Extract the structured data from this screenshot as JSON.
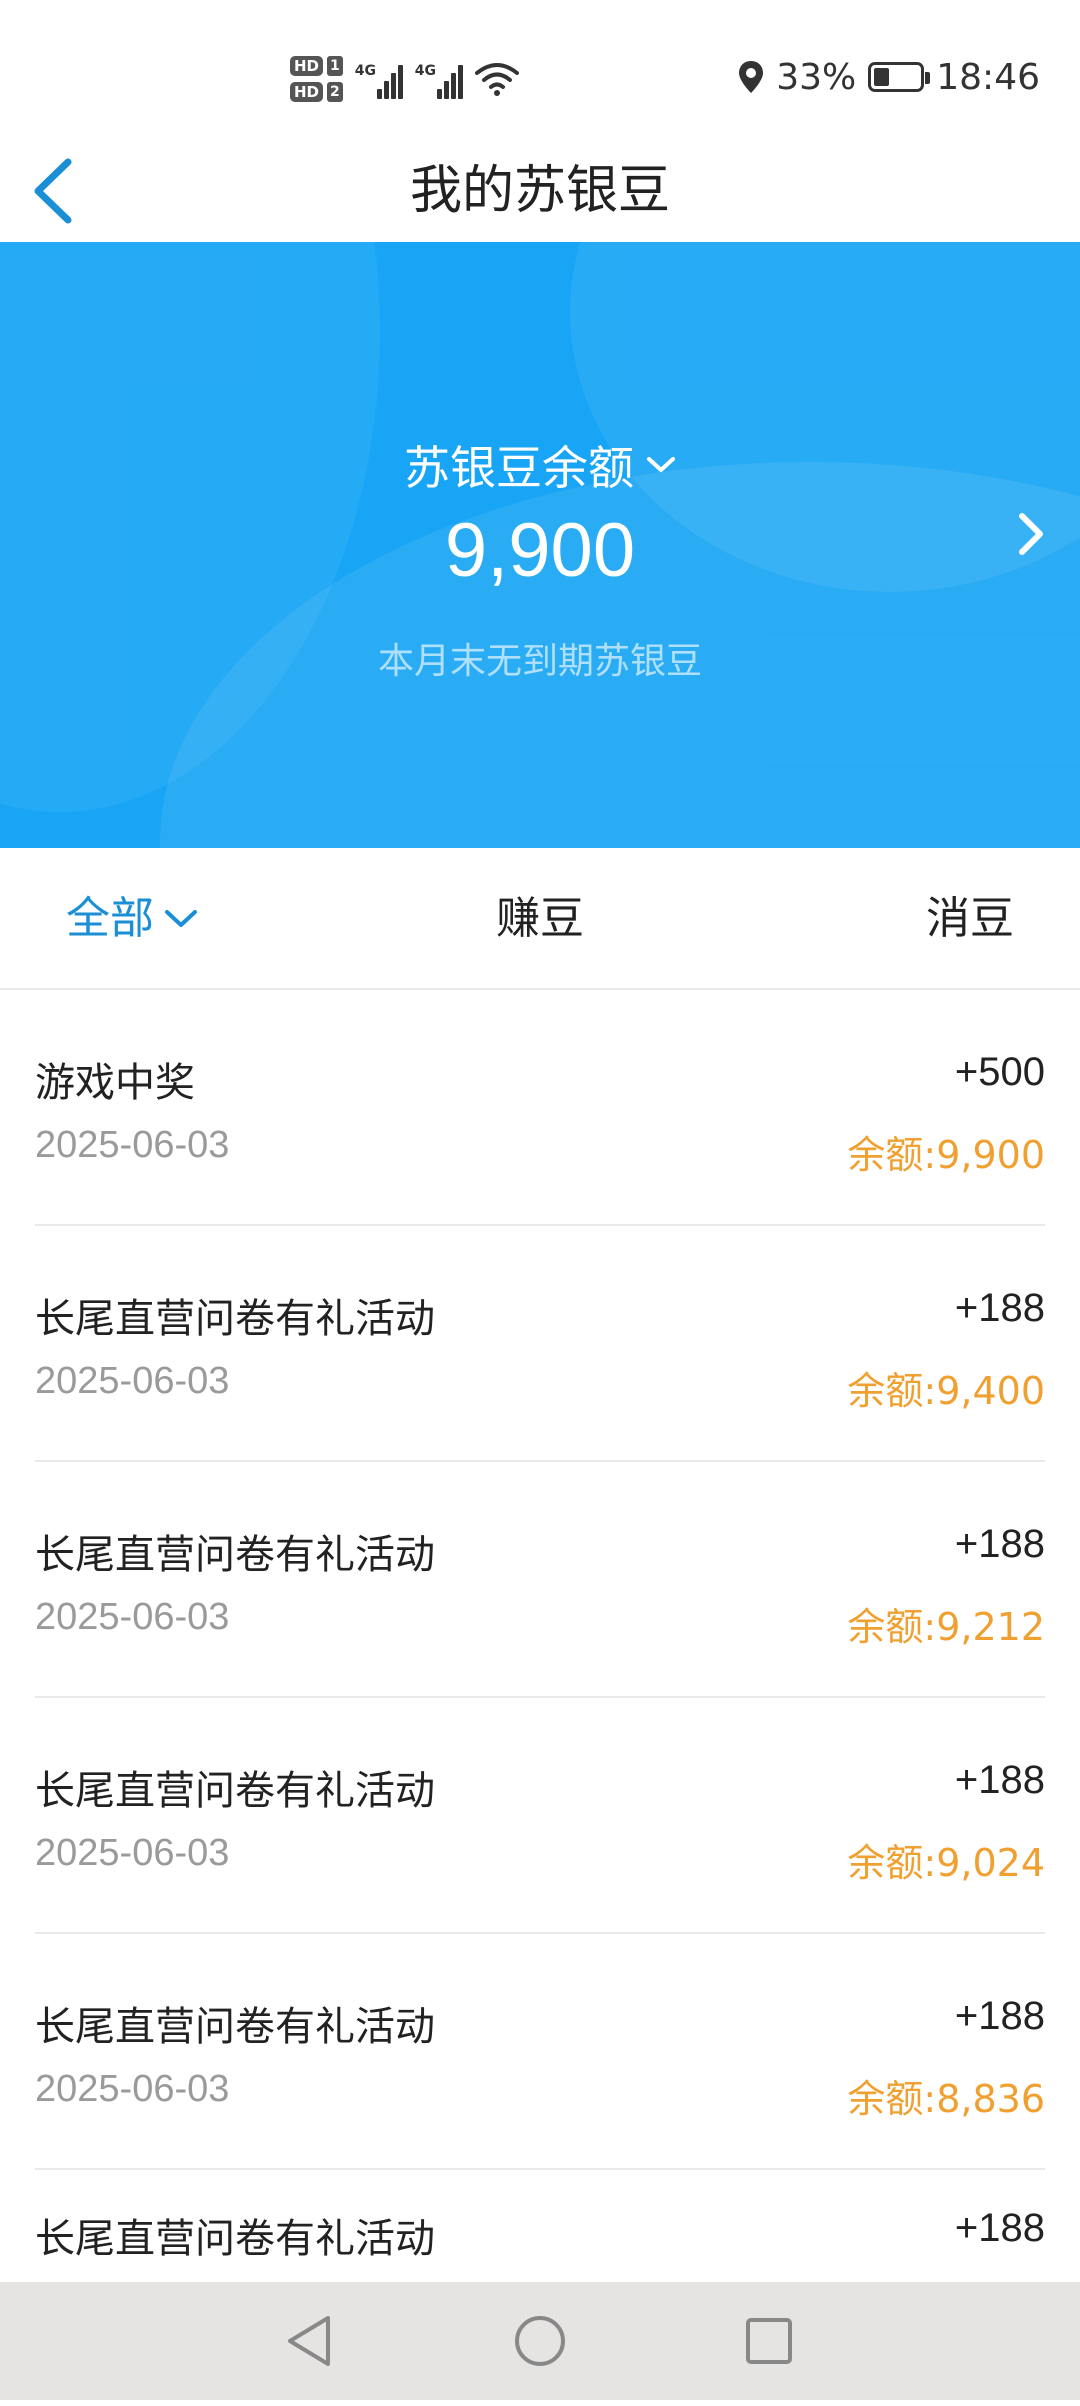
{
  "status_bar": {
    "sim1": "HD",
    "sim1_num": "1",
    "sim2": "HD",
    "sim2_num": "2",
    "net1": "4G",
    "net2": "4G",
    "battery": "33%",
    "time": "18:46"
  },
  "header": {
    "title": "我的苏银豆"
  },
  "banner": {
    "label": "苏银豆余额",
    "balance": "9,900",
    "note": "本月末无到期苏银豆",
    "color": "#18a5f5"
  },
  "tabs": {
    "all": "全部",
    "earn": "赚豆",
    "spend": "消豆",
    "active_color": "#1a8fd6"
  },
  "transactions": [
    {
      "title": "游戏中奖",
      "amount": "+500",
      "date": "2025-06-03",
      "balance": "余额:9,900"
    },
    {
      "title": "长尾直营问卷有礼活动",
      "amount": "+188",
      "date": "2025-06-03",
      "balance": "余额:9,400"
    },
    {
      "title": "长尾直营问卷有礼活动",
      "amount": "+188",
      "date": "2025-06-03",
      "balance": "余额:9,212"
    },
    {
      "title": "长尾直营问卷有礼活动",
      "amount": "+188",
      "date": "2025-06-03",
      "balance": "余额:9,024"
    },
    {
      "title": "长尾直营问卷有礼活动",
      "amount": "+188",
      "date": "2025-06-03",
      "balance": "余额:8,836"
    },
    {
      "title": "长尾直营问卷有礼活动",
      "amount": "+188",
      "date": "",
      "balance": ""
    }
  ]
}
